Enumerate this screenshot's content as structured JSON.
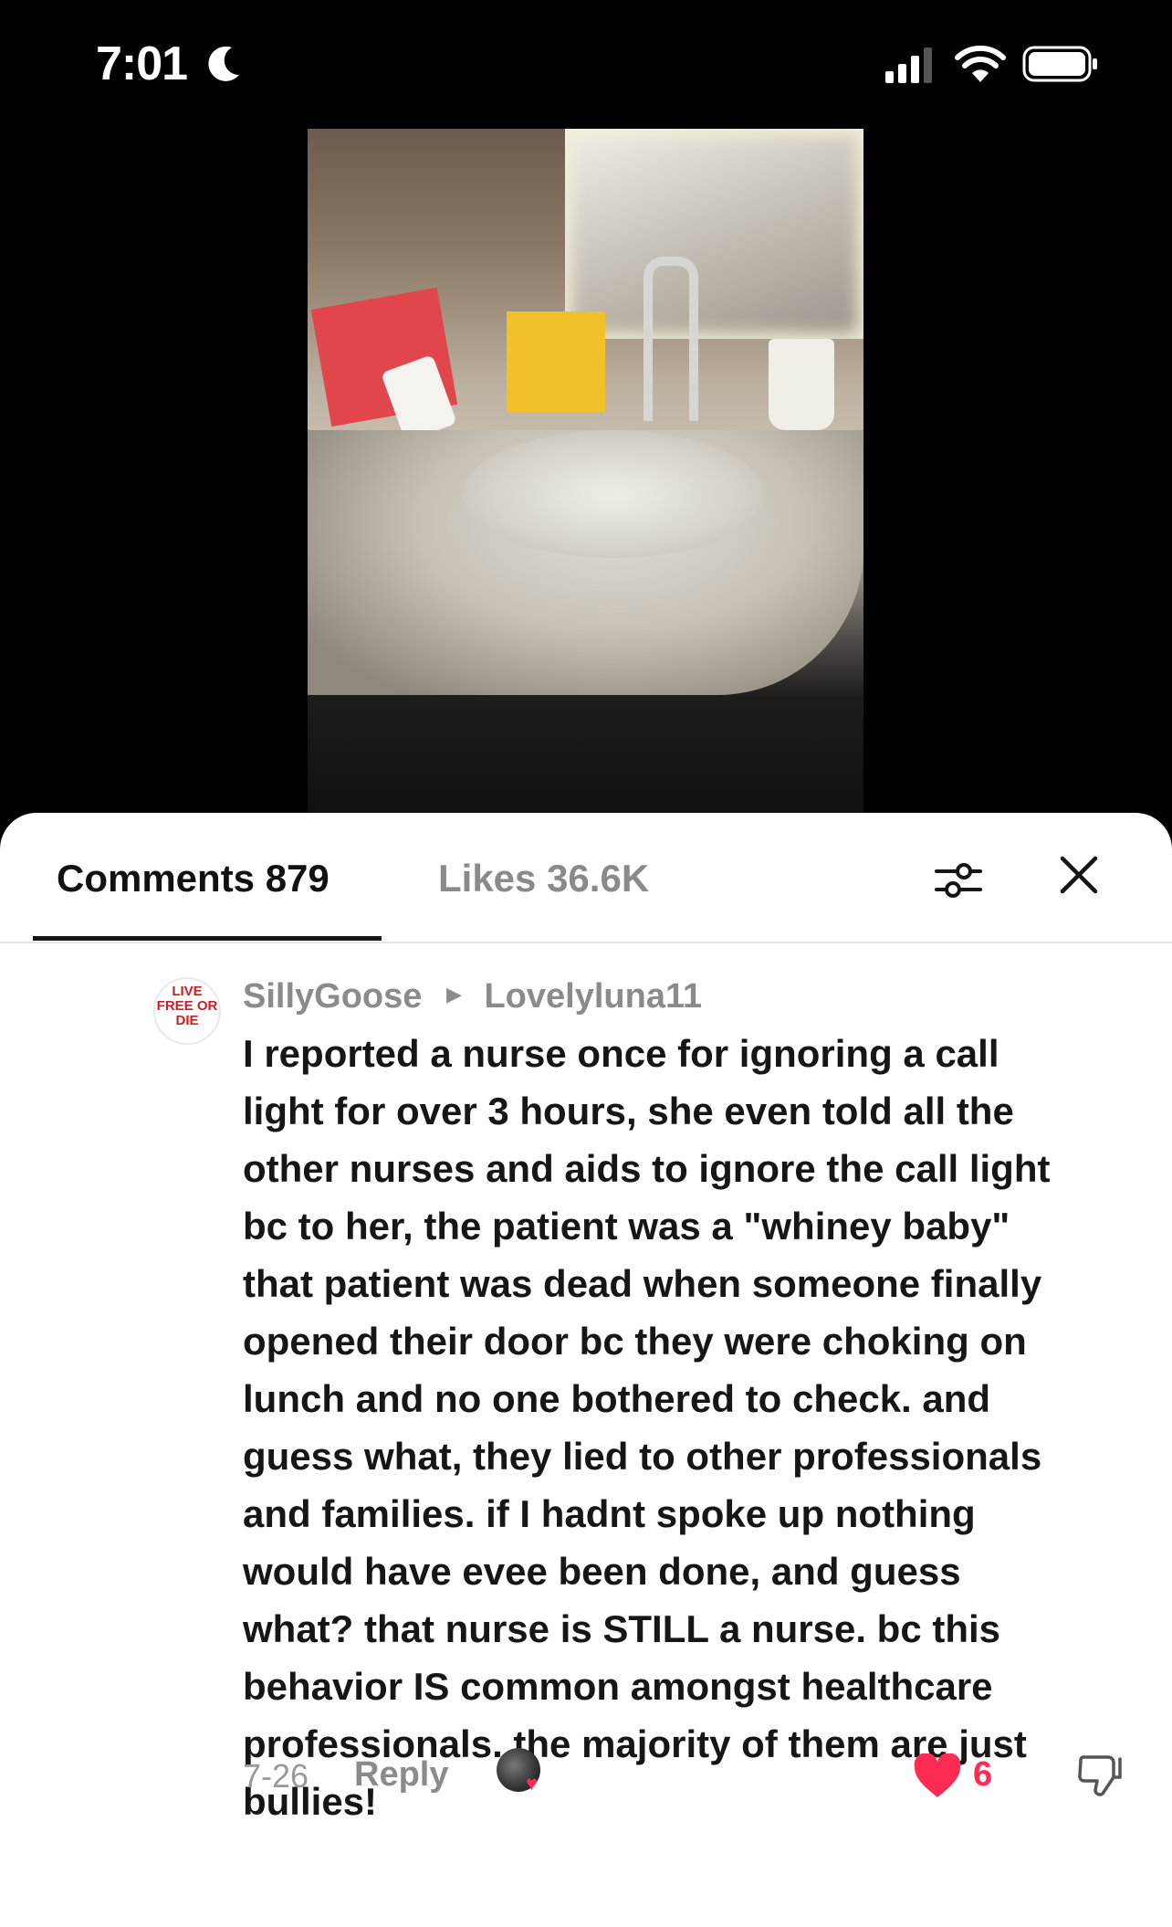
{
  "status_bar": {
    "time": "7:01",
    "icons": [
      "moon-icon",
      "cellular-signal-icon",
      "wifi-icon",
      "battery-icon"
    ]
  },
  "sheet": {
    "tabs": {
      "comments_label": "Comments 879",
      "likes_label": "Likes 36.6K",
      "active": "comments"
    },
    "icons": [
      "filter-icon",
      "close-icon"
    ]
  },
  "comment": {
    "avatar_text": "LIVE FREE OR DIE",
    "username": "SillyGoose",
    "reply_to": "Lovelyluna11",
    "lines": [
      "I reported a nurse once for ignoring a call",
      "light for over 3 hours, she even told all the",
      "other nurses and aids to ignore the call light",
      "bc to her, the patient was a \"whiney baby\"",
      "that patient was dead when someone finally",
      "opened their door bc they were choking on",
      "lunch and no one bothered to check. and",
      "guess what, they lied to other professionals",
      "and families. if I hadnt spoke up nothing",
      "would have evee been done, and guess",
      "what? that nurse is STILL a nurse. bc this",
      "behavior IS common amongst healthcare",
      "professionals. the majority of them are just",
      "bullies!"
    ],
    "date": "7-26",
    "reply_label": "Reply",
    "like_count": "6",
    "colors": {
      "like": "#fe2c55"
    }
  }
}
